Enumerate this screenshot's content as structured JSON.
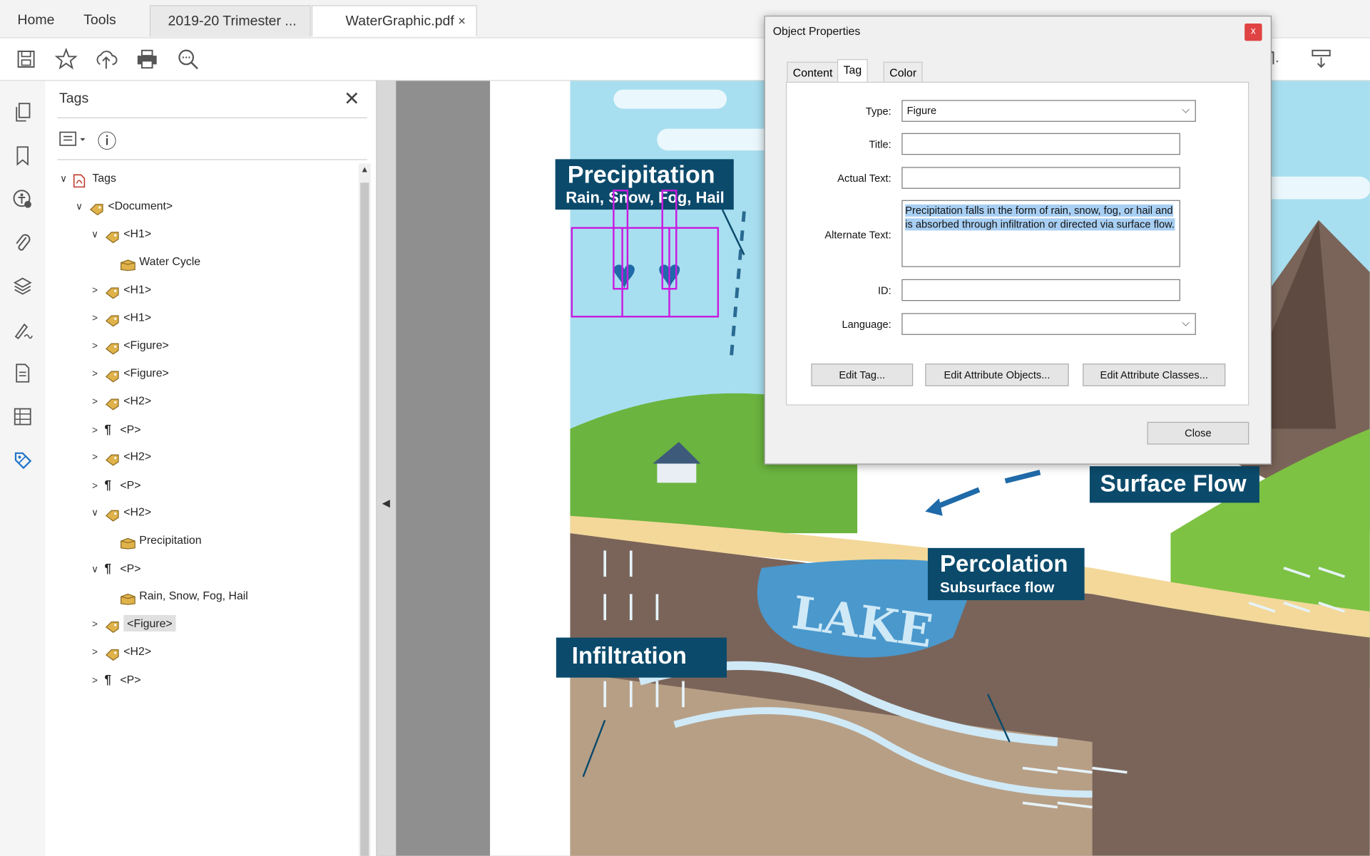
{
  "tabs": {
    "home": "Home",
    "tools": "Tools",
    "doc1": "2019-20 Trimester ...",
    "active": "WaterGraphic.pdf",
    "close_glyph": "×"
  },
  "toolbar": {
    "icons": [
      "save-icon",
      "bookmark-star-icon",
      "cloud-upload-icon",
      "print-icon",
      "zoom-search-icon"
    ]
  },
  "panel": {
    "title": "Tags",
    "close_glyph": "✕",
    "info_glyph": "ⓘ"
  },
  "tree": [
    {
      "chev": "∨",
      "kind": "pdf",
      "label": "Tags"
    },
    {
      "chev": "∨",
      "kind": "tag",
      "label": "<Document>"
    },
    {
      "chev": "∨",
      "kind": "tag",
      "label": "<H1>"
    },
    {
      "chev": "",
      "kind": "content",
      "label": "Water Cycle"
    },
    {
      "chev": ">",
      "kind": "tag",
      "label": "<H1>"
    },
    {
      "chev": ">",
      "kind": "tag",
      "label": "<H1>"
    },
    {
      "chev": ">",
      "kind": "tag",
      "label": "<Figure>"
    },
    {
      "chev": ">",
      "kind": "tag",
      "label": "<Figure>"
    },
    {
      "chev": ">",
      "kind": "tag",
      "label": "<H2>"
    },
    {
      "chev": ">",
      "kind": "para",
      "label": "<P>"
    },
    {
      "chev": ">",
      "kind": "tag",
      "label": "<H2>"
    },
    {
      "chev": ">",
      "kind": "para",
      "label": "<P>"
    },
    {
      "chev": "∨",
      "kind": "tag",
      "label": "<H2>"
    },
    {
      "chev": "",
      "kind": "content",
      "label": "Precipitation"
    },
    {
      "chev": "∨",
      "kind": "para",
      "label": "<P>"
    },
    {
      "chev": "",
      "kind": "content",
      "label": "Rain, Snow, Fog, Hail"
    },
    {
      "chev": ">",
      "kind": "tag",
      "label": "<Figure>",
      "selected": true
    },
    {
      "chev": ">",
      "kind": "tag",
      "label": "<H2>"
    },
    {
      "chev": ">",
      "kind": "para",
      "label": "<P>"
    }
  ],
  "artwork": {
    "precip_title": "Precipitation",
    "precip_sub": "Rain, Snow, Fog, Hail",
    "surface_flow": "Surface Flow",
    "percolation_title": "Percolation",
    "percolation_sub": "Subsurface flow",
    "infiltration": "Infiltration",
    "lake": "LAKE"
  },
  "dialog": {
    "title": "Object Properties",
    "close_glyph": "x",
    "tabs": [
      "Content",
      "Tag",
      "Color"
    ],
    "labels": {
      "type": "Type:",
      "title": "Title:",
      "actual_text": "Actual Text:",
      "alternate_text": "Alternate Text:",
      "id": "ID:",
      "language": "Language:"
    },
    "values": {
      "type": "Figure",
      "title": "",
      "actual_text": "",
      "alternate_text": "Precipitation falls in the form of rain, snow, fog, or hail and is absorbed through infiltration or directed via surface flow.",
      "id": "",
      "language": ""
    },
    "buttons": {
      "edit_tag": "Edit Tag...",
      "edit_attr_objects": "Edit Attribute Objects...",
      "edit_attr_classes": "Edit Attribute Classes...",
      "close": "Close"
    }
  },
  "colors": {
    "label_bg": "#0b4a6b",
    "magenta": "#c71ce0",
    "selection": "#a8cff3"
  }
}
